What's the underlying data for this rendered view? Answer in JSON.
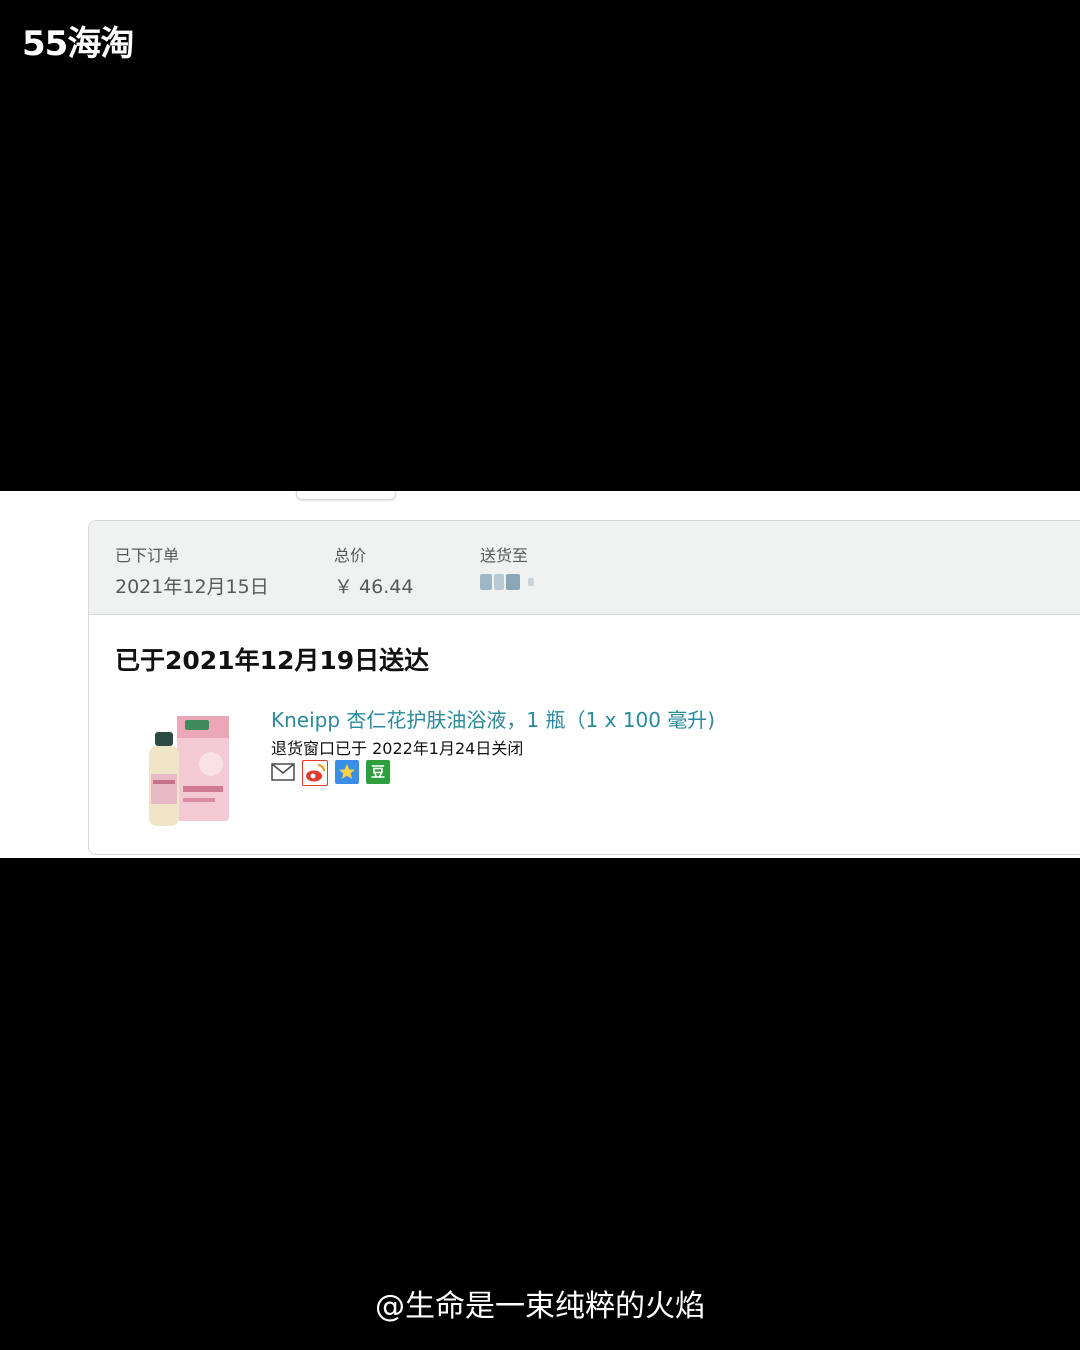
{
  "watermark": "55海淘",
  "order": {
    "placed_label": "已下订单",
    "placed_date": "2021年12月15日",
    "total_label": "总价",
    "total_value": "￥ 46.44",
    "ship_to_label": "送货至"
  },
  "delivery_status": "已于2021年12月19日送达",
  "item": {
    "title": "Kneipp 杏仁花护肤油浴液，1 瓶（1 x 100 毫升)",
    "return_note": "退货窗口已于 2022年1月24日关闭",
    "share_icons": [
      "email-icon",
      "weibo-icon",
      "qzone-icon",
      "douban-icon"
    ],
    "douban_glyph": "豆"
  },
  "colors": {
    "link": "#2a8a9a",
    "header_bg": "#f0f2f2",
    "border": "#d5d9d9"
  },
  "caption": "@生命是一束纯粹的火焰"
}
